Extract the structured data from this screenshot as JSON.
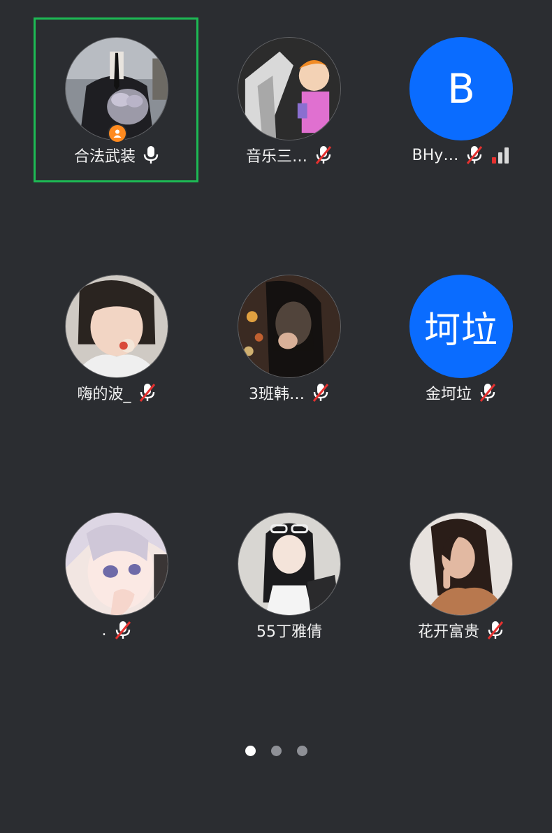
{
  "participants": [
    {
      "name": "合法武装",
      "muted": false,
      "host": true,
      "active": true
    },
    {
      "name": "音乐三…",
      "muted": true
    },
    {
      "name": "BHy…",
      "muted": true,
      "letter": "B",
      "signal": "weak"
    },
    {
      "name": "嗨的波_",
      "muted": true
    },
    {
      "name": "3班韩…",
      "muted": true
    },
    {
      "name": "金坷垃",
      "muted": true,
      "letter": "坷垃"
    },
    {
      "name": ".",
      "muted": true
    },
    {
      "name": "55丁雅倩",
      "muted": false
    },
    {
      "name": "花开富贵",
      "muted": true
    }
  ],
  "colors": {
    "background": "#2b2d31",
    "active_border": "#1db954",
    "letter_avatar": "#0a6cff",
    "host_badge": "#ff8a1f",
    "mute_slash": "#e5312f"
  },
  "pagination": {
    "total": 3,
    "current": 1
  }
}
